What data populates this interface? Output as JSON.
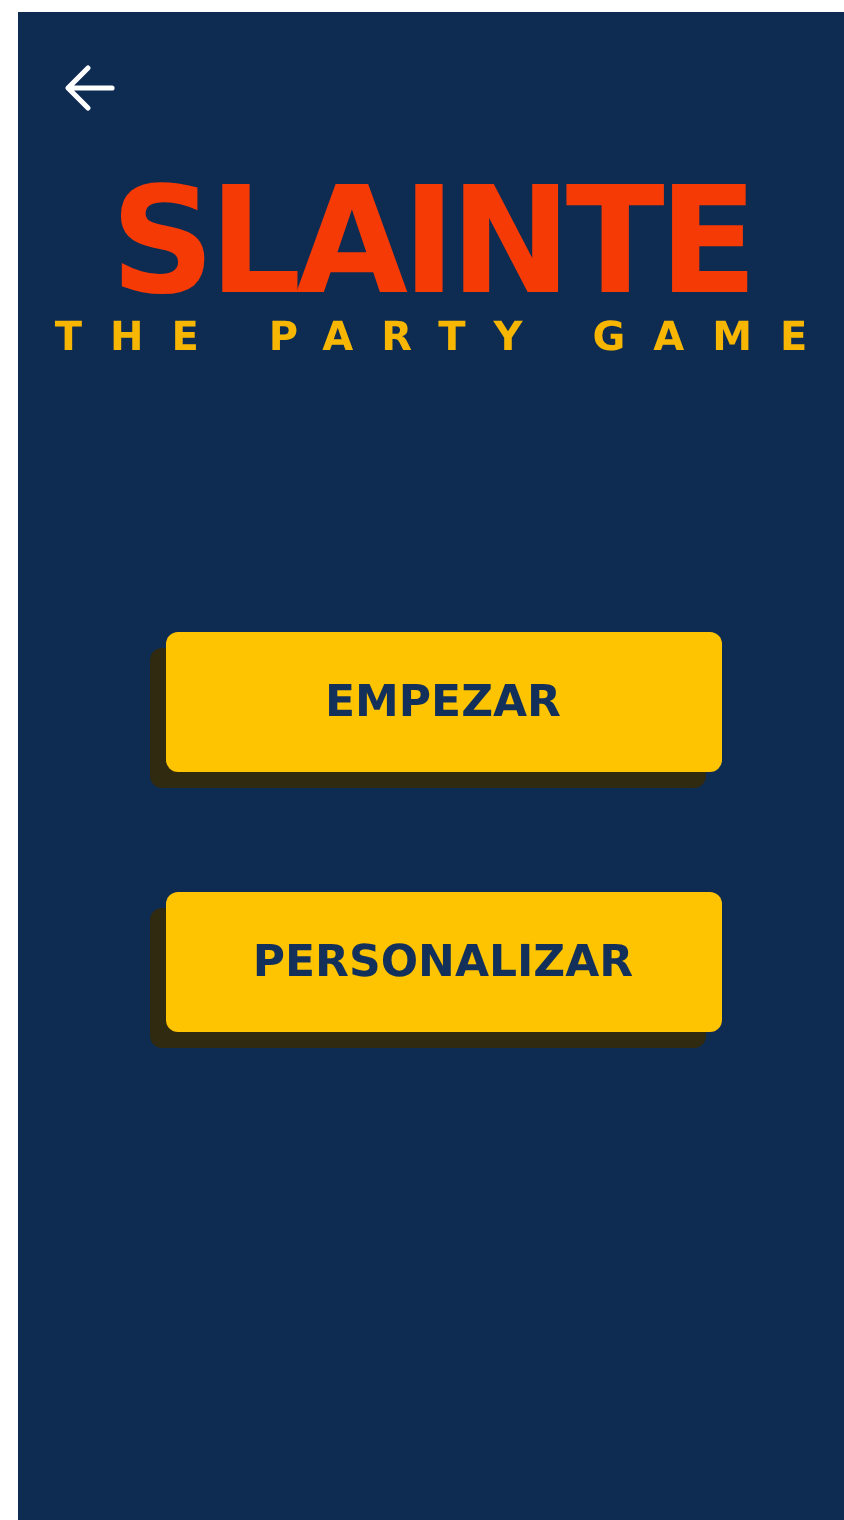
{
  "logo": {
    "title": "SLAINTE",
    "subtitle": "THE PARTY GAME"
  },
  "buttons": [
    "EMPEZAR",
    "PERSONALIZAR"
  ]
}
